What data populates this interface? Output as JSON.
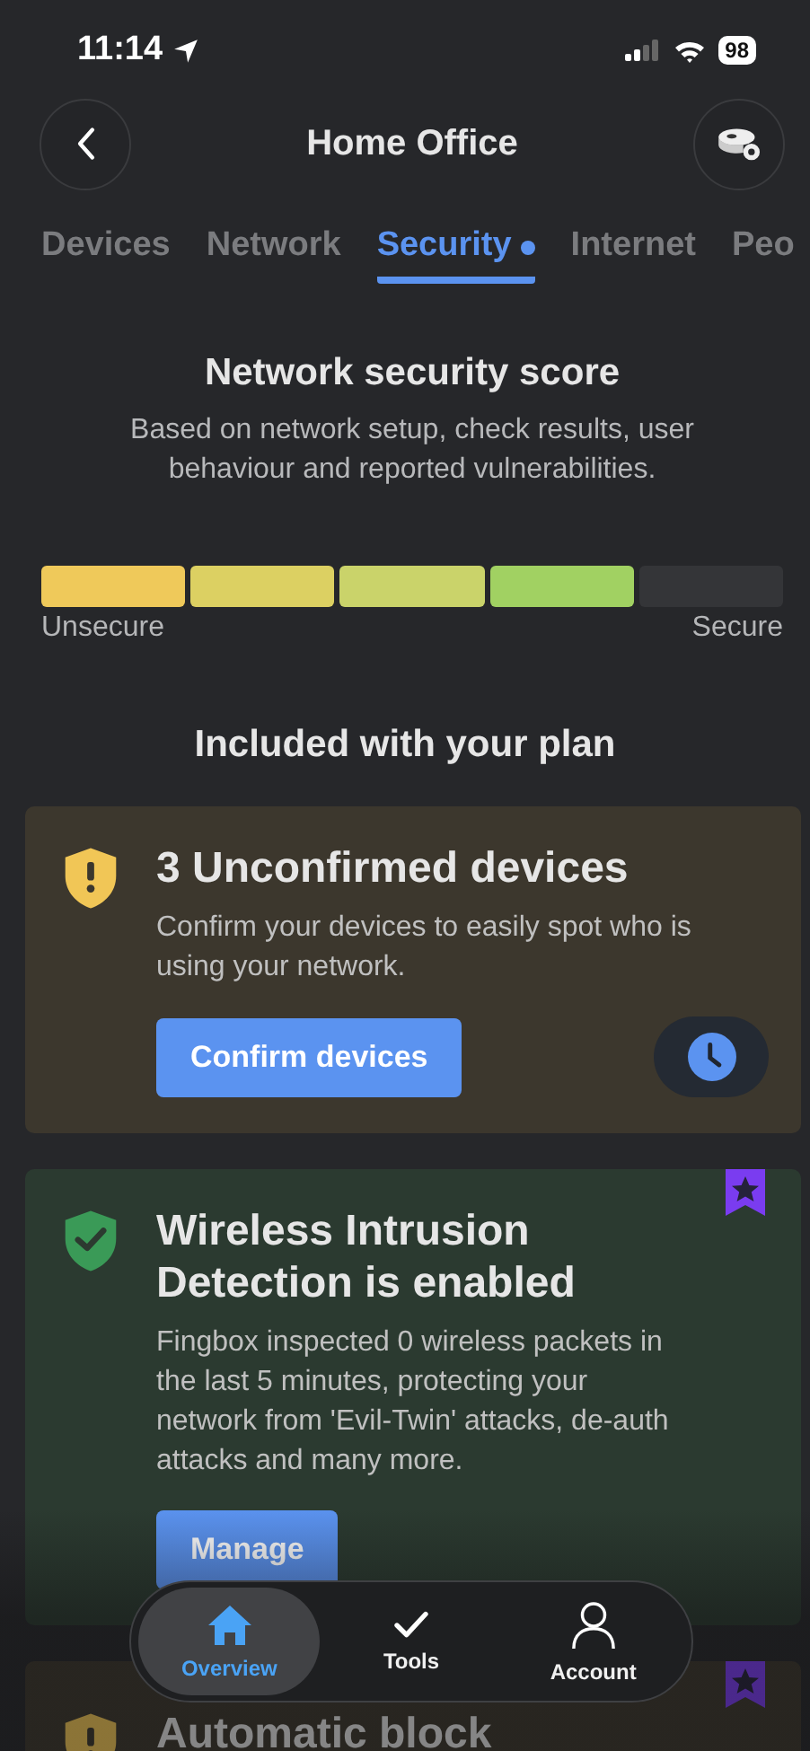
{
  "status_bar": {
    "time": "11:14",
    "battery": "98"
  },
  "header": {
    "title": "Home Office"
  },
  "tabs": [
    {
      "label": "Devices",
      "selected": false,
      "dot": false
    },
    {
      "label": "Network",
      "selected": false,
      "dot": false
    },
    {
      "label": "Security",
      "selected": true,
      "dot": true
    },
    {
      "label": "Internet",
      "selected": false,
      "dot": false
    },
    {
      "label": "Peo",
      "selected": false,
      "dot": false
    }
  ],
  "score": {
    "title": "Network security score",
    "description": "Based on network setup, check results, user behaviour and reported vulnerabilities.",
    "segments": [
      {
        "color": "#efc95a"
      },
      {
        "color": "#dcd062"
      },
      {
        "color": "#cad36a"
      },
      {
        "color": "#a1d162"
      },
      {
        "color": "#343538"
      }
    ],
    "min_label": "Unsecure",
    "max_label": "Secure"
  },
  "plan_title": "Included with your plan",
  "cards": [
    {
      "kind": "warning",
      "title": "3 Unconfirmed devices",
      "text": "Confirm your devices to easily spot who is using your network.",
      "button": "Confirm devices",
      "premium": false,
      "snooze": true
    },
    {
      "kind": "ok",
      "title": "Wireless Intrusion Detection is enabled",
      "text": "Fingbox inspected 0 wireless packets in the last 5 minutes, protecting your network from 'Evil-Twin' attacks, de-auth attacks and many more.",
      "button": "Manage",
      "premium": true
    },
    {
      "kind": "warning",
      "title": "Automatic block",
      "premium": true
    }
  ],
  "nav": [
    {
      "label": "Overview",
      "selected": true
    },
    {
      "label": "Tools",
      "selected": false
    },
    {
      "label": "Account",
      "selected": false
    }
  ]
}
